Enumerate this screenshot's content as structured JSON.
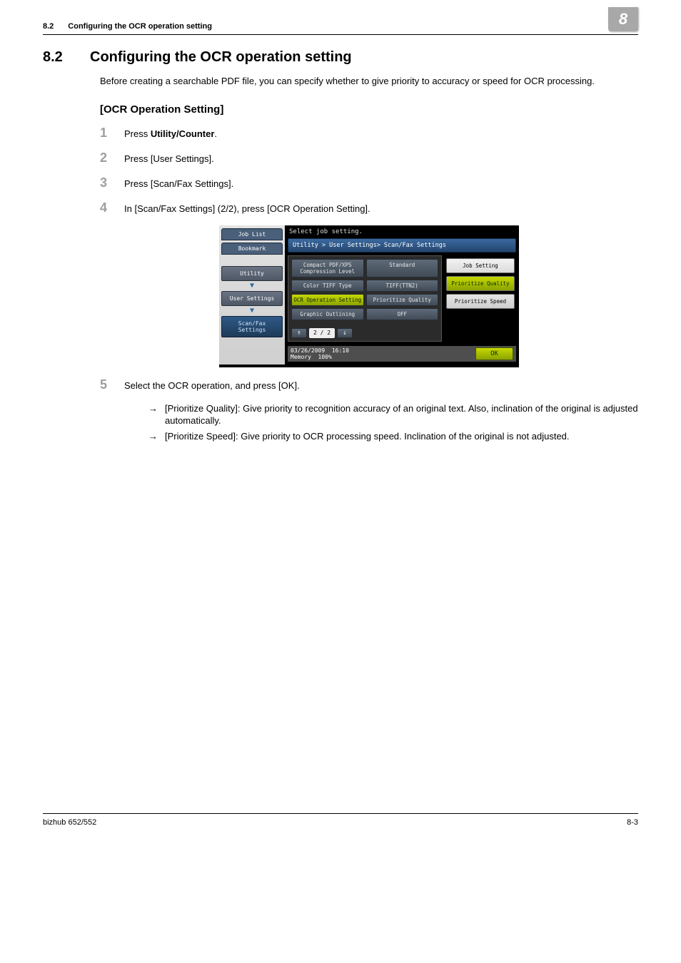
{
  "header": {
    "num": "8.2",
    "title": "Configuring the OCR operation setting",
    "chapter": "8"
  },
  "section": {
    "num": "8.2",
    "title": "Configuring the OCR operation setting"
  },
  "intro": "Before creating a searchable PDF file, you can specify whether to give priority to accuracy or speed for OCR processing.",
  "subheading": "[OCR Operation Setting]",
  "steps": [
    {
      "n": "1",
      "pre": "Press ",
      "bold": "Utility/Counter",
      "post": "."
    },
    {
      "n": "2",
      "pre": "Press [User Settings].",
      "bold": "",
      "post": ""
    },
    {
      "n": "3",
      "pre": "Press [Scan/Fax Settings].",
      "bold": "",
      "post": ""
    },
    {
      "n": "4",
      "pre": "In [Scan/Fax Settings] (2/2), press [OCR Operation Setting].",
      "bold": "",
      "post": ""
    },
    {
      "n": "5",
      "pre": "Select the OCR operation, and press [OK].",
      "bold": "",
      "post": ""
    }
  ],
  "bullets": [
    "[Prioritize Quality]: Give priority to recognition accuracy of an original text. Also, inclination of the original is adjusted automatically.",
    "[Prioritize Speed]: Give priority to OCR processing speed. Inclination of the original is not adjusted."
  ],
  "screen": {
    "prompt": "Select job setting.",
    "tabs": {
      "joblist": "Job List",
      "bookmark": "Bookmark"
    },
    "side": {
      "utility": "Utility",
      "user": "User Settings",
      "scanfax": "Scan/Fax\nSettings"
    },
    "breadcrumb": "Utility > User Settings> Scan/Fax Settings",
    "rows": [
      {
        "label": "Compact PDF/XPS\nCompression Level",
        "value": "Standard"
      },
      {
        "label": "Color TIFF Type",
        "value": "TIFF(TTN2)"
      },
      {
        "label": "OCR Operation Setting",
        "value": "Prioritize Quality",
        "sel": true
      },
      {
        "label": "Graphic Outlining",
        "value": "OFF"
      }
    ],
    "options": {
      "header": "Job Setting",
      "quality": "Prioritize Quality",
      "speed": "Prioritize Speed"
    },
    "pager": "2 / 2",
    "footer": {
      "date": "03/26/2009",
      "time": "16:10",
      "mem": "Memory",
      "memv": "100%",
      "ok": "OK"
    }
  },
  "footer": {
    "left": "bizhub 652/552",
    "right": "8-3"
  }
}
